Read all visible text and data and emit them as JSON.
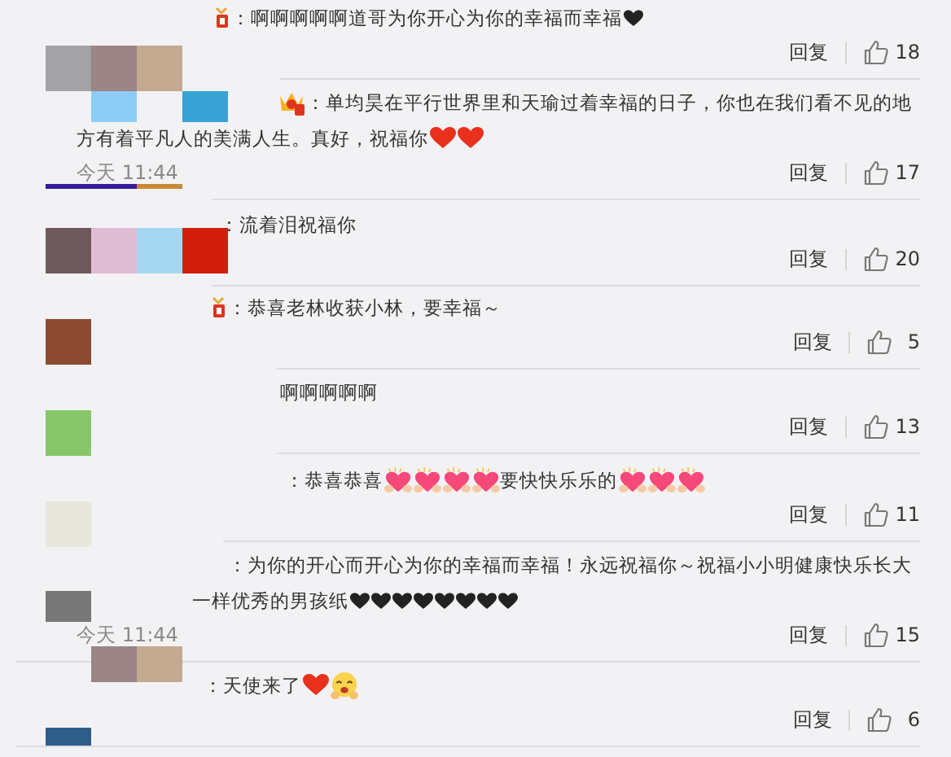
{
  "comments": [
    {
      "badge": {
        "kind": "medal"
      },
      "lines": [
        [
          {
            "kind": "text",
            "text": "：啊啊啊啊啊道哥为你开心为你的幸福而幸福"
          },
          {
            "kind": "black-heart"
          }
        ]
      ],
      "reply": "回复",
      "likes": "18"
    },
    {
      "badge": {
        "kind": "crown"
      },
      "lines": [
        [
          {
            "kind": "text",
            "text": "：单均昊在平行世界里和天瑜过着幸福的日子，你也在我们看不见的地"
          }
        ],
        [
          {
            "kind": "text",
            "text": "方有着平凡人的美满人生。真好，祝福你"
          },
          {
            "kind": "red-heart"
          },
          {
            "kind": "red-heart"
          }
        ]
      ],
      "time": "今天 11:44",
      "reply": "回复",
      "likes": "17"
    },
    {
      "lines": [
        [
          {
            "kind": "text",
            "text": "：流着泪祝福你"
          }
        ]
      ],
      "reply": "回复",
      "likes": "20"
    },
    {
      "badge": {
        "kind": "medal"
      },
      "lines": [
        [
          {
            "kind": "text",
            "text": "：恭喜"
          },
          {
            "kind": "text",
            "text": "老林收获小林，要幸福～"
          }
        ]
      ],
      "reply": "回复",
      "likes": "5"
    },
    {
      "lines": [
        [
          {
            "kind": "text",
            "text": "啊啊啊啊啊"
          }
        ]
      ],
      "reply": "回复",
      "likes": "13"
    },
    {
      "lines": [
        [
          {
            "kind": "text",
            "text": "：恭喜恭喜"
          },
          {
            "kind": "pink-heart"
          },
          {
            "kind": "pink-heart"
          },
          {
            "kind": "pink-heart"
          },
          {
            "kind": "pink-heart"
          },
          {
            "kind": "text",
            "text": "要快快乐乐的"
          },
          {
            "kind": "pink-heart"
          },
          {
            "kind": "pink-heart"
          },
          {
            "kind": "pink-heart"
          }
        ]
      ],
      "reply": "回复",
      "likes": "11"
    },
    {
      "lines": [
        [
          {
            "kind": "text",
            "text": "：为你的开心而开心为你的幸福而幸福！永远祝福你～祝福小小明健康快乐长大"
          }
        ],
        [
          {
            "kind": "text",
            "text": "一样优秀的男孩纸"
          },
          {
            "kind": "black-heart"
          },
          {
            "kind": "black-heart"
          },
          {
            "kind": "black-heart"
          },
          {
            "kind": "black-heart"
          },
          {
            "kind": "black-heart"
          },
          {
            "kind": "black-heart"
          },
          {
            "kind": "black-heart"
          },
          {
            "kind": "black-heart"
          }
        ]
      ],
      "time": "今天 11:44",
      "reply": "回复",
      "likes": "15"
    },
    {
      "lines": [
        [
          {
            "kind": "text",
            "text": "：天使来了"
          },
          {
            "kind": "red-heart"
          },
          {
            "kind": "smile"
          }
        ]
      ],
      "reply": "回复",
      "likes": "6"
    }
  ]
}
